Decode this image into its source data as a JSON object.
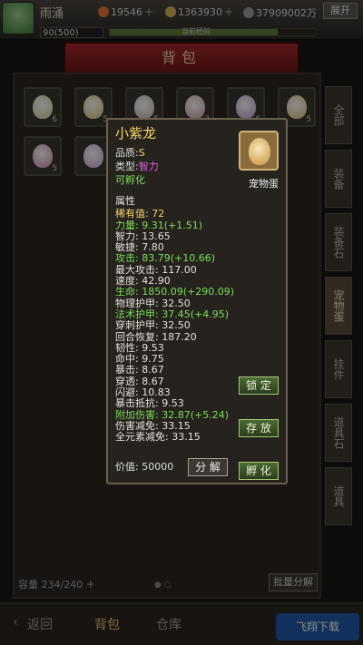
{
  "player": {
    "name": "雨涌",
    "level_text": "90(500)",
    "xp_text": "当前经验",
    "xp_fraction": 0.82
  },
  "currencies": [
    {
      "icon": "coin-icon",
      "amount": "19546"
    },
    {
      "icon": "gem-icon",
      "amount": "1363930"
    },
    {
      "icon": "gold-icon",
      "amount": "37909002万"
    }
  ],
  "expand_label": "展开",
  "bag_title": "背包",
  "slots": [
    {
      "count": "6",
      "color": "#d9d0a4"
    },
    {
      "count": "5",
      "color": "#d8c77a"
    },
    {
      "count": "5",
      "color": "#c9b6b0"
    },
    {
      "count": "3",
      "color": "#c99fae"
    },
    {
      "count": "6",
      "color": "#b99ec9"
    },
    {
      "count": "5",
      "color": "#e0c07a"
    },
    {
      "count": "5",
      "color": "#cf8fb0"
    },
    {
      "count": "",
      "color": "#c8a6d8"
    }
  ],
  "side_tabs": [
    "全部",
    "装备",
    "装备石",
    "宠物蛋",
    "挂件",
    "道具石",
    "道具"
  ],
  "active_side_tab": 3,
  "capacity_label": "容量",
  "capacity_value": "234/240",
  "batch_label": "批量分解",
  "bottom_tabs": [
    "返回",
    "背包",
    "仓库"
  ],
  "watermark": "飞翔下载",
  "item": {
    "name": "小紫龙",
    "quality_label": "品质:",
    "quality_value": "S",
    "type_label": "类型:",
    "type_value": "智力",
    "hatchable": "可孵化",
    "pet_type": "宠物蛋",
    "attr_header": "属性",
    "attrs": [
      {
        "text": "稀有值: 72",
        "color": "y"
      },
      {
        "text": "力量: 9.31(+1.51)",
        "color": "g"
      },
      {
        "text": "智力: 13.65",
        "color": ""
      },
      {
        "text": "敏捷: 7.80",
        "color": ""
      },
      {
        "text": "攻击: 83.79(+10.66)",
        "color": "g"
      },
      {
        "text": "最大攻击: 117.00",
        "color": ""
      },
      {
        "text": "速度: 42.90",
        "color": ""
      },
      {
        "text": "生命: 1850.09(+290.09)",
        "color": "g"
      },
      {
        "text": "物理护甲: 32.50",
        "color": ""
      },
      {
        "text": "法术护甲: 37.45(+4.95)",
        "color": "g"
      },
      {
        "text": "穿刺护甲: 32.50",
        "color": ""
      },
      {
        "text": "回合恢复: 187.20",
        "color": ""
      },
      {
        "text": "韧性: 9.53",
        "color": ""
      },
      {
        "text": "命中: 9.75",
        "color": ""
      },
      {
        "text": "暴击: 8.67",
        "color": ""
      },
      {
        "text": "穿透: 8.67",
        "color": ""
      },
      {
        "text": "闪避: 10.83",
        "color": ""
      },
      {
        "text": "暴击抵抗: 9.53",
        "color": ""
      },
      {
        "text": "附加伤害: 32.87(+5.24)",
        "color": "g"
      },
      {
        "text": "伤害减免: 33.15",
        "color": ""
      },
      {
        "text": "全元素减免: 33.15",
        "color": ""
      }
    ],
    "price_label": "价值:",
    "price_value": "50000",
    "lock_label": "锁 定",
    "store_label": "存 放",
    "hatch_label": "孵 化",
    "split_label": "分 解"
  }
}
